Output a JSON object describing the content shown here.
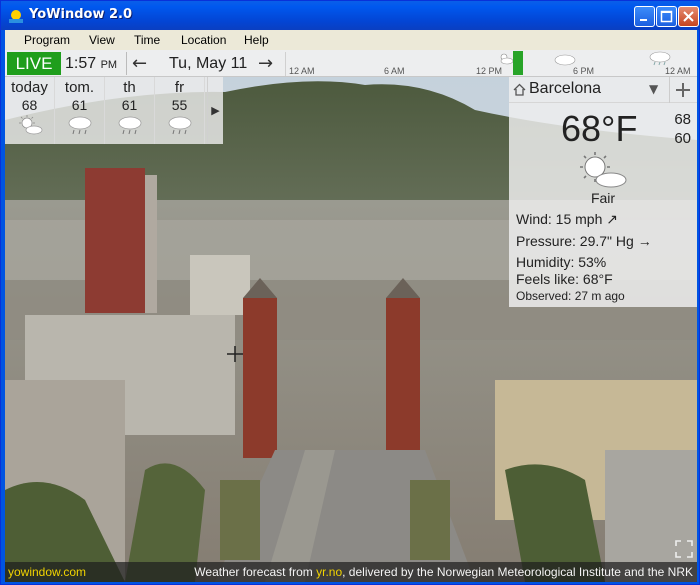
{
  "window": {
    "title": "YoWindow 2.0"
  },
  "menu": [
    "Program",
    "View",
    "Time",
    "Location",
    "Help"
  ],
  "timebar": {
    "live_label": "LIVE",
    "time": "1:57",
    "time_suffix": "PM",
    "date": "Tu, May 11",
    "ticks": [
      "12 AM",
      "6 AM",
      "12 PM",
      "6 PM",
      "12 AM"
    ]
  },
  "forecast": [
    {
      "day": "today",
      "temp": "68",
      "icon": "sun-cloud-icon"
    },
    {
      "day": "tom.",
      "temp": "61",
      "icon": "rain-cloud-icon"
    },
    {
      "day": "th",
      "temp": "61",
      "icon": "rain-cloud-icon"
    },
    {
      "day": "fr",
      "temp": "55",
      "icon": "rain-cloud-icon"
    }
  ],
  "current": {
    "city": "Barcelona",
    "temperature": "68°F",
    "high": "68",
    "low": "60",
    "condition": "Fair",
    "wind": "Wind:  15 mph ↗",
    "pressure": "Pressure:  29.7\" Hg  →",
    "humidity": "Humidity:  53%",
    "feels_like": "Feels like:  68°F",
    "observed": "Observed:  27 m ago"
  },
  "status": {
    "source": "yowindow.com",
    "credit_prefix": "Weather forecast from ",
    "credit_link": "yr.no",
    "credit_suffix": ", delivered by the Norwegian Meteorological Institute and the NRK"
  },
  "colors": {
    "live": "#1f9e1c",
    "status_link": "#f1d300",
    "title_bar": "#0054e3"
  }
}
